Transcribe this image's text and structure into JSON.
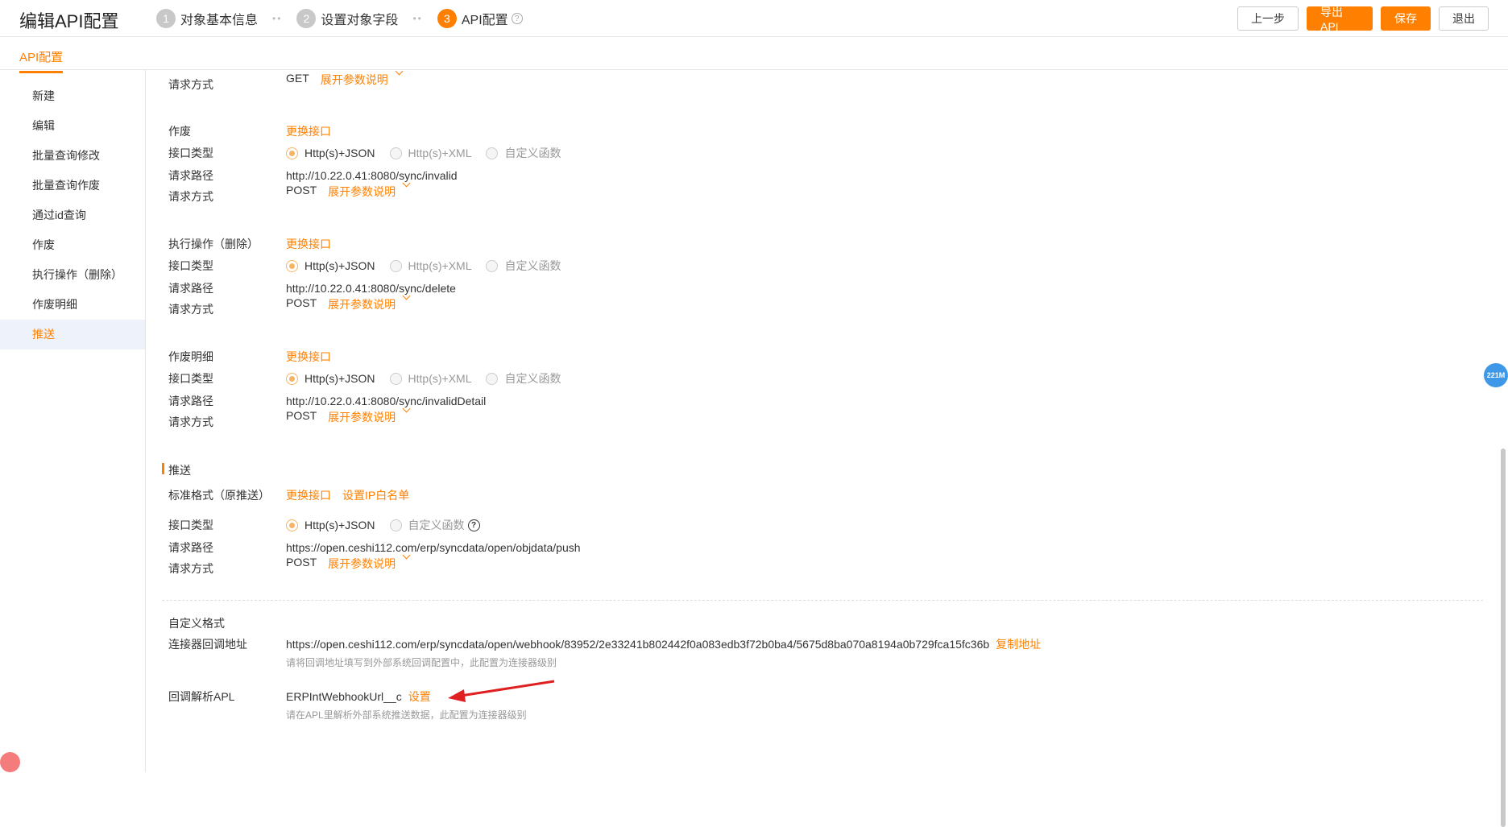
{
  "header": {
    "title": "编辑API配置",
    "steps": [
      {
        "num": "1",
        "label": "对象基本信息"
      },
      {
        "num": "2",
        "label": "设置对象字段"
      },
      {
        "num": "3",
        "label": "API配置"
      }
    ],
    "step_sep": "••",
    "help": "?",
    "buttons": {
      "prev": "上一步",
      "export": "导出API",
      "save": "保存",
      "exit": "退出"
    }
  },
  "tab": "API配置",
  "sidebar": {
    "items": [
      "新建",
      "编辑",
      "批量查询修改",
      "批量查询作废",
      "通过id查询",
      "作废",
      "执行操作（删除）",
      "作废明细",
      "推送"
    ]
  },
  "labels": {
    "interface_type": "接口类型",
    "request_path": "请求路径",
    "request_method": "请求方式",
    "change_interface": "更换接口",
    "expand_params": "展开参数说明",
    "http_json": "Http(s)+JSON",
    "http_xml": "Http(s)+XML",
    "custom_func": "自定义函数"
  },
  "top_partial": {
    "method": "GET"
  },
  "blocks": [
    {
      "title": "作废",
      "path": "http://10.22.0.41:8080/sync/invalid",
      "method": "POST"
    },
    {
      "title": "执行操作（删除）",
      "path": "http://10.22.0.41:8080/sync/delete",
      "method": "POST"
    },
    {
      "title": "作废明细",
      "path": "http://10.22.0.41:8080/sync/invalidDetail",
      "method": "POST"
    }
  ],
  "push": {
    "section_title": "推送",
    "standard_label": "标准格式（原推送）",
    "ip_whitelist": "设置IP白名单",
    "path": "https://open.ceshi112.com/erp/syncdata/open/objdata/push",
    "method": "POST"
  },
  "custom": {
    "title": "自定义格式",
    "callback_label": "连接器回调地址",
    "callback_url": "https://open.ceshi112.com/erp/syncdata/open/webhook/83952/2e33241b802442f0a083edb3f72b0ba4/5675d8ba070a8194a0b729fca15fc36b",
    "copy": "复制地址",
    "callback_hint": "请将回调地址填写到外部系统回调配置中，此配置为连接器级别",
    "apl_label": "回调解析APL",
    "apl_value": "ERPIntWebhookUrl__c",
    "apl_set": "设置",
    "apl_hint": "请在APL里解析外部系统推送数据，此配置为连接器级别"
  },
  "memory_badge": "221M",
  "colors": {
    "accent": "#ff8000",
    "active_bg": "#eef3fb",
    "arrow": "#e02020"
  }
}
